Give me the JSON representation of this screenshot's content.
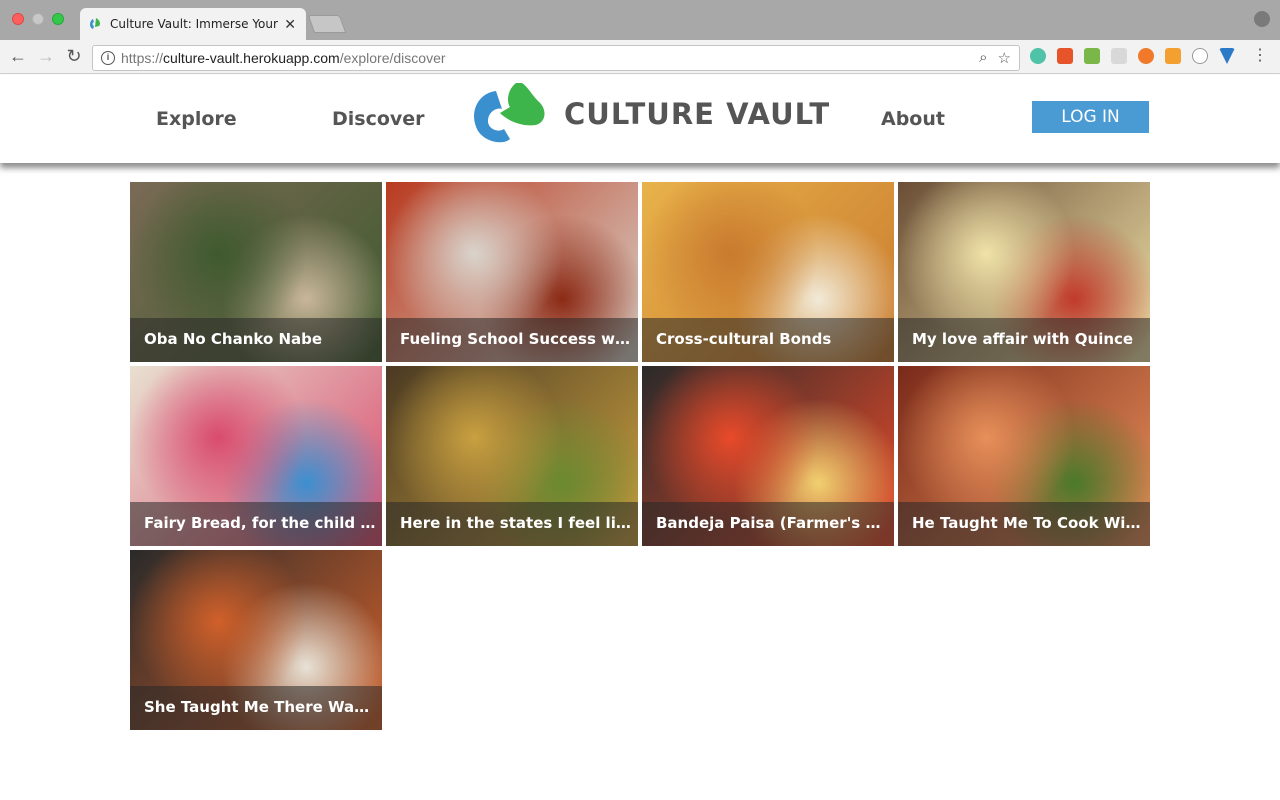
{
  "browser": {
    "tab_title": "Culture Vault: Immerse Yourself",
    "url_scheme": "https://",
    "url_host": "culture-vault.herokuapp.com",
    "url_path": "/explore/discover"
  },
  "header": {
    "nav_explore": "Explore",
    "nav_discover": "Discover",
    "logo_text": "CULTURE VAULT",
    "nav_about": "About",
    "login_label": "LOG IN",
    "colors": {
      "accent_blue": "#4a9ad3",
      "logo_green": "#3db54a",
      "logo_blue": "#3a8fcf"
    }
  },
  "cards": [
    {
      "title": "Oba No Chanko Nabe",
      "colors": [
        "#7a6a55",
        "#3f5a2e",
        "#c9b69a"
      ]
    },
    {
      "title": "Fueling School Success with Can...",
      "colors": [
        "#b83a1f",
        "#d9d4cc",
        "#8b2a15"
      ]
    },
    {
      "title": "Cross-cultural Bonds",
      "colors": [
        "#e8b24a",
        "#c97a2e",
        "#f1ead8"
      ]
    },
    {
      "title": "My love affair with Quince",
      "colors": [
        "#6a4e36",
        "#f0e2a8",
        "#c23a2b"
      ]
    },
    {
      "title": "Fairy Bread, for the child within ...",
      "colors": [
        "#e8e0d0",
        "#d94b6e",
        "#3c8fd0"
      ]
    },
    {
      "title": "Here in the states I feel like a stra...",
      "colors": [
        "#4a3a22",
        "#c9a040",
        "#6a8a30"
      ]
    },
    {
      "title": "Bandeja Paisa (Farmer's Platter)",
      "colors": [
        "#2a2a2a",
        "#e84a2a",
        "#f2d070"
      ]
    },
    {
      "title": "He Taught Me To Cook With Fire",
      "colors": [
        "#7a2a1a",
        "#e8905a",
        "#4a7a2a"
      ]
    },
    {
      "title": "She Taught Me There Was Streng...",
      "colors": [
        "#2a2a2a",
        "#d0602a",
        "#e8e2d6"
      ]
    }
  ]
}
